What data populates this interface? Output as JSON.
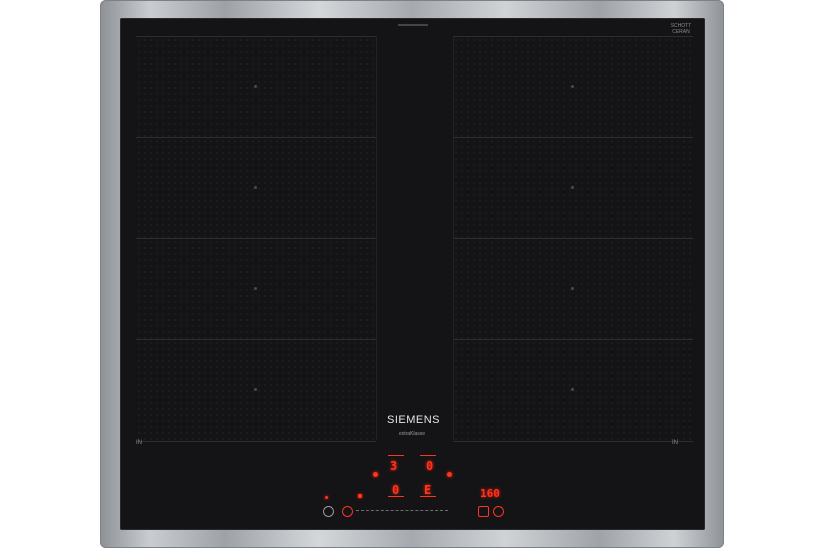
{
  "brand": "SIEMENS",
  "subbrand": "extraKlasse",
  "glass_brand": "SCHOTT CERAN",
  "zone_labels": {
    "left": "IN",
    "right": "IN"
  },
  "displays": {
    "level_top_left": "3",
    "level_top_right": "0",
    "level_bottom_left": "0",
    "level_bottom_right": "E",
    "timer": "160"
  },
  "colors": {
    "glass": "#141416",
    "frame": "#b8bbbf",
    "display": "#ff3322"
  },
  "icons": [
    "power-icon",
    "wifi-icon",
    "lock-icon",
    "boost-icon",
    "timer-icon",
    "pan-icon"
  ]
}
